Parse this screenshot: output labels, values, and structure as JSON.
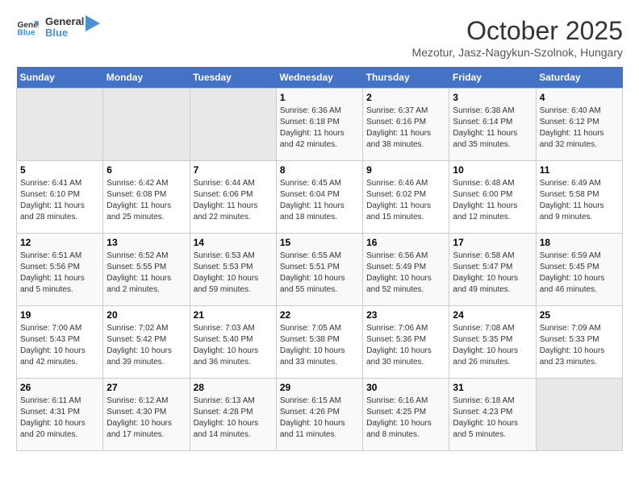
{
  "header": {
    "logo_line1": "General",
    "logo_line2": "Blue",
    "month_title": "October 2025",
    "subtitle": "Mezotur, Jasz-Nagykun-Szolnok, Hungary"
  },
  "weekdays": [
    "Sunday",
    "Monday",
    "Tuesday",
    "Wednesday",
    "Thursday",
    "Friday",
    "Saturday"
  ],
  "weeks": [
    [
      {
        "day": "",
        "empty": true
      },
      {
        "day": "",
        "empty": true
      },
      {
        "day": "",
        "empty": true
      },
      {
        "day": "1",
        "sunrise": "6:36 AM",
        "sunset": "6:18 PM",
        "daylight": "11 hours and 42 minutes."
      },
      {
        "day": "2",
        "sunrise": "6:37 AM",
        "sunset": "6:16 PM",
        "daylight": "11 hours and 38 minutes."
      },
      {
        "day": "3",
        "sunrise": "6:38 AM",
        "sunset": "6:14 PM",
        "daylight": "11 hours and 35 minutes."
      },
      {
        "day": "4",
        "sunrise": "6:40 AM",
        "sunset": "6:12 PM",
        "daylight": "11 hours and 32 minutes."
      }
    ],
    [
      {
        "day": "5",
        "sunrise": "6:41 AM",
        "sunset": "6:10 PM",
        "daylight": "11 hours and 28 minutes."
      },
      {
        "day": "6",
        "sunrise": "6:42 AM",
        "sunset": "6:08 PM",
        "daylight": "11 hours and 25 minutes."
      },
      {
        "day": "7",
        "sunrise": "6:44 AM",
        "sunset": "6:06 PM",
        "daylight": "11 hours and 22 minutes."
      },
      {
        "day": "8",
        "sunrise": "6:45 AM",
        "sunset": "6:04 PM",
        "daylight": "11 hours and 18 minutes."
      },
      {
        "day": "9",
        "sunrise": "6:46 AM",
        "sunset": "6:02 PM",
        "daylight": "11 hours and 15 minutes."
      },
      {
        "day": "10",
        "sunrise": "6:48 AM",
        "sunset": "6:00 PM",
        "daylight": "11 hours and 12 minutes."
      },
      {
        "day": "11",
        "sunrise": "6:49 AM",
        "sunset": "5:58 PM",
        "daylight": "11 hours and 9 minutes."
      }
    ],
    [
      {
        "day": "12",
        "sunrise": "6:51 AM",
        "sunset": "5:56 PM",
        "daylight": "11 hours and 5 minutes."
      },
      {
        "day": "13",
        "sunrise": "6:52 AM",
        "sunset": "5:55 PM",
        "daylight": "11 hours and 2 minutes."
      },
      {
        "day": "14",
        "sunrise": "6:53 AM",
        "sunset": "5:53 PM",
        "daylight": "10 hours and 59 minutes."
      },
      {
        "day": "15",
        "sunrise": "6:55 AM",
        "sunset": "5:51 PM",
        "daylight": "10 hours and 55 minutes."
      },
      {
        "day": "16",
        "sunrise": "6:56 AM",
        "sunset": "5:49 PM",
        "daylight": "10 hours and 52 minutes."
      },
      {
        "day": "17",
        "sunrise": "6:58 AM",
        "sunset": "5:47 PM",
        "daylight": "10 hours and 49 minutes."
      },
      {
        "day": "18",
        "sunrise": "6:59 AM",
        "sunset": "5:45 PM",
        "daylight": "10 hours and 46 minutes."
      }
    ],
    [
      {
        "day": "19",
        "sunrise": "7:00 AM",
        "sunset": "5:43 PM",
        "daylight": "10 hours and 42 minutes."
      },
      {
        "day": "20",
        "sunrise": "7:02 AM",
        "sunset": "5:42 PM",
        "daylight": "10 hours and 39 minutes."
      },
      {
        "day": "21",
        "sunrise": "7:03 AM",
        "sunset": "5:40 PM",
        "daylight": "10 hours and 36 minutes."
      },
      {
        "day": "22",
        "sunrise": "7:05 AM",
        "sunset": "5:38 PM",
        "daylight": "10 hours and 33 minutes."
      },
      {
        "day": "23",
        "sunrise": "7:06 AM",
        "sunset": "5:36 PM",
        "daylight": "10 hours and 30 minutes."
      },
      {
        "day": "24",
        "sunrise": "7:08 AM",
        "sunset": "5:35 PM",
        "daylight": "10 hours and 26 minutes."
      },
      {
        "day": "25",
        "sunrise": "7:09 AM",
        "sunset": "5:33 PM",
        "daylight": "10 hours and 23 minutes."
      }
    ],
    [
      {
        "day": "26",
        "sunrise": "6:11 AM",
        "sunset": "4:31 PM",
        "daylight": "10 hours and 20 minutes."
      },
      {
        "day": "27",
        "sunrise": "6:12 AM",
        "sunset": "4:30 PM",
        "daylight": "10 hours and 17 minutes."
      },
      {
        "day": "28",
        "sunrise": "6:13 AM",
        "sunset": "4:28 PM",
        "daylight": "10 hours and 14 minutes."
      },
      {
        "day": "29",
        "sunrise": "6:15 AM",
        "sunset": "4:26 PM",
        "daylight": "10 hours and 11 minutes."
      },
      {
        "day": "30",
        "sunrise": "6:16 AM",
        "sunset": "4:25 PM",
        "daylight": "10 hours and 8 minutes."
      },
      {
        "day": "31",
        "sunrise": "6:18 AM",
        "sunset": "4:23 PM",
        "daylight": "10 hours and 5 minutes."
      },
      {
        "day": "",
        "empty": true
      }
    ]
  ],
  "labels": {
    "sunrise": "Sunrise:",
    "sunset": "Sunset:",
    "daylight": "Daylight:"
  }
}
